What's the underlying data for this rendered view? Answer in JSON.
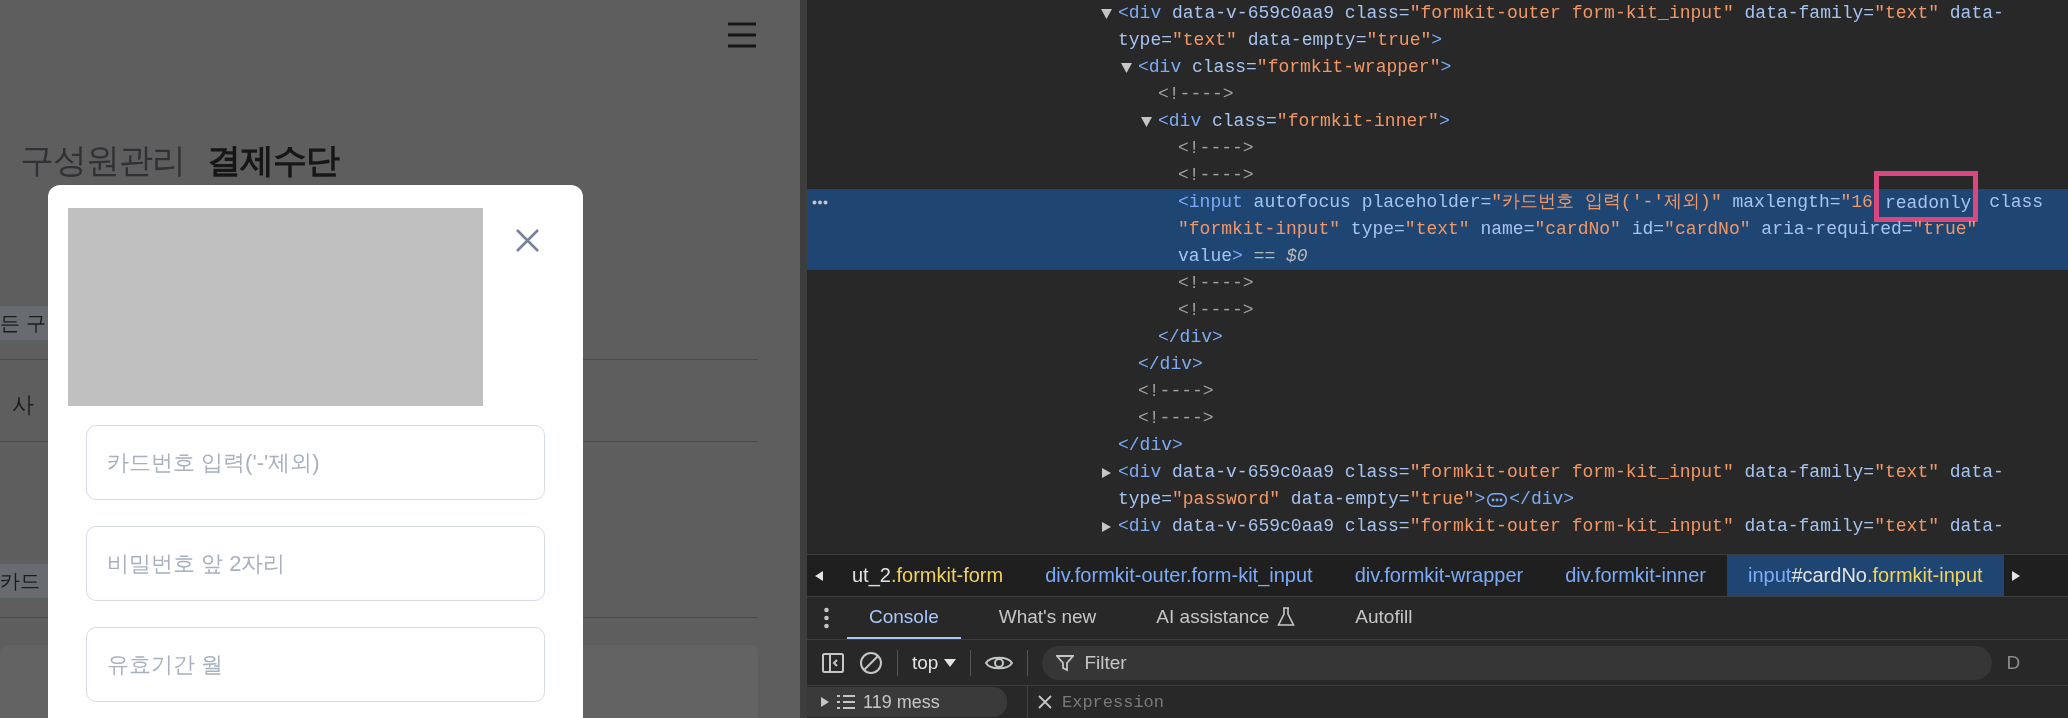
{
  "page": {
    "heading_tabs": [
      {
        "label": "구성원관리",
        "selected": false
      },
      {
        "label": "결제수단",
        "selected": true
      }
    ],
    "background_rows": [
      {
        "kind": "chip",
        "text": "든 구"
      },
      {
        "kind": "text",
        "text": "사"
      },
      {
        "kind": "chip",
        "text": "카드"
      }
    ]
  },
  "modal": {
    "fields": [
      {
        "placeholder": "카드번호 입력('-'제외)"
      },
      {
        "placeholder": "비밀번호 앞 2자리"
      },
      {
        "placeholder": "유효기간 월"
      }
    ]
  },
  "devtools": {
    "elements_tree": [
      {
        "expanded": true,
        "selected": false,
        "lines": [
          [
            {
              "kind": "tag",
              "text": "<div"
            },
            {
              "kind": "attr",
              "text": " data-v-659c0aa9 class="
            },
            {
              "kind": "value",
              "text": "\"formkit-outer form-kit_input\""
            },
            {
              "kind": "attr",
              "text": " data-family="
            },
            {
              "kind": "value",
              "text": "\"text\""
            },
            {
              "kind": "attr",
              "text": " data-"
            }
          ],
          [
            {
              "kind": "attr",
              "text": "type="
            },
            {
              "kind": "value",
              "text": "\"text\""
            },
            {
              "kind": "attr",
              "text": " data-empty="
            },
            {
              "kind": "value",
              "text": "\"true\""
            },
            {
              "kind": "tag",
              "text": ">"
            }
          ]
        ],
        "children": [
          {
            "expanded": true,
            "selected": false,
            "lines": [
              [
                {
                  "kind": "tag",
                  "text": "<div"
                },
                {
                  "kind": "attr",
                  "text": " class="
                },
                {
                  "kind": "value",
                  "text": "\"formkit-wrapper\""
                },
                {
                  "kind": "tag",
                  "text": ">"
                }
              ]
            ],
            "children": [
              {
                "selected": false,
                "lines": [
                  [
                    {
                      "kind": "comment",
                      "text": "<!---->"
                    }
                  ]
                ]
              },
              {
                "expanded": true,
                "selected": false,
                "lines": [
                  [
                    {
                      "kind": "tag",
                      "text": "<div"
                    },
                    {
                      "kind": "attr",
                      "text": " class="
                    },
                    {
                      "kind": "value",
                      "text": "\"formkit-inner\""
                    },
                    {
                      "kind": "tag",
                      "text": ">"
                    }
                  ]
                ],
                "children": [
                  {
                    "selected": false,
                    "lines": [
                      [
                        {
                          "kind": "comment",
                          "text": "<!---->"
                        }
                      ]
                    ]
                  },
                  {
                    "selected": false,
                    "lines": [
                      [
                        {
                          "kind": "comment",
                          "text": "<!---->"
                        }
                      ]
                    ]
                  },
                  {
                    "selected": true,
                    "lines": [
                      [
                        {
                          "kind": "tag",
                          "text": "<input"
                        },
                        {
                          "kind": "attr",
                          "text": " autofocus placeholder="
                        },
                        {
                          "kind": "value",
                          "text": "\"카드번호 입력('-'제외)\""
                        },
                        {
                          "kind": "attr",
                          "text": " maxlength="
                        },
                        {
                          "kind": "value",
                          "text": "\"16"
                        },
                        {
                          "kind": "highlight",
                          "text": "readonly"
                        },
                        {
                          "kind": "attr",
                          "text": " class"
                        }
                      ],
                      [
                        {
                          "kind": "value",
                          "text": "\"formkit-input\""
                        },
                        {
                          "kind": "attr",
                          "text": " type="
                        },
                        {
                          "kind": "value",
                          "text": "\"text\""
                        },
                        {
                          "kind": "attr",
                          "text": " name="
                        },
                        {
                          "kind": "value",
                          "text": "\"cardNo\""
                        },
                        {
                          "kind": "attr",
                          "text": " id="
                        },
                        {
                          "kind": "value",
                          "text": "\"cardNo\""
                        },
                        {
                          "kind": "attr",
                          "text": " aria-required="
                        },
                        {
                          "kind": "value",
                          "text": "\"true\""
                        }
                      ],
                      [
                        {
                          "kind": "attr",
                          "text": "value"
                        },
                        {
                          "kind": "tag",
                          "text": ">"
                        },
                        {
                          "kind": "hint",
                          "text": " == "
                        },
                        {
                          "kind": "var",
                          "text": "$0"
                        }
                      ]
                    ]
                  },
                  {
                    "selected": false,
                    "lines": [
                      [
                        {
                          "kind": "comment",
                          "text": "<!---->"
                        }
                      ]
                    ]
                  },
                  {
                    "selected": false,
                    "lines": [
                      [
                        {
                          "kind": "comment",
                          "text": "<!---->"
                        }
                      ]
                    ]
                  }
                ],
                "closing": [
                  {
                    "kind": "tag",
                    "text": "</div>"
                  }
                ]
              }
            ],
            "closing": [
              {
                "kind": "tag",
                "text": "</div>"
              }
            ]
          },
          {
            "selected": false,
            "lines": [
              [
                {
                  "kind": "comment",
                  "text": "<!---->"
                }
              ]
            ]
          },
          {
            "selected": false,
            "lines": [
              [
                {
                  "kind": "comment",
                  "text": "<!---->"
                }
              ]
            ]
          }
        ],
        "closing": [
          {
            "kind": "tag",
            "text": "</div>"
          }
        ]
      },
      {
        "expanded": false,
        "selected": false,
        "lines": [
          [
            {
              "kind": "tag",
              "text": "<div"
            },
            {
              "kind": "attr",
              "text": " data-v-659c0aa9 class="
            },
            {
              "kind": "value",
              "text": "\"formkit-outer form-kit_input\""
            },
            {
              "kind": "attr",
              "text": " data-family="
            },
            {
              "kind": "value",
              "text": "\"text\""
            },
            {
              "kind": "attr",
              "text": " data-"
            }
          ],
          [
            {
              "kind": "attr",
              "text": "type="
            },
            {
              "kind": "value",
              "text": "\"password\""
            },
            {
              "kind": "attr",
              "text": " data-empty="
            },
            {
              "kind": "value",
              "text": "\"true\""
            },
            {
              "kind": "tag",
              "text": ">"
            },
            {
              "kind": "more"
            },
            {
              "kind": "tag",
              "text": "</div>"
            }
          ]
        ]
      },
      {
        "expanded": false,
        "selected": false,
        "lines": [
          [
            {
              "kind": "tag",
              "text": "<div"
            },
            {
              "kind": "attr",
              "text": " data-v-659c0aa9 class="
            },
            {
              "kind": "value",
              "text": "\"formkit-outer form-kit_input\""
            },
            {
              "kind": "attr",
              "text": " data-family="
            },
            {
              "kind": "value",
              "text": "\"text\""
            },
            {
              "kind": "attr",
              "text": " data-"
            }
          ]
        ]
      }
    ],
    "breadcrumbs": [
      {
        "selected": false,
        "parts": [
          {
            "kind": "id",
            "text": "ut_2"
          },
          {
            "kind": "class",
            "text": ".formkit-form"
          }
        ]
      },
      {
        "selected": false,
        "parts": [
          {
            "kind": "tag",
            "text": "div.formkit-outer.form-kit_input"
          }
        ]
      },
      {
        "selected": false,
        "parts": [
          {
            "kind": "tag",
            "text": "div.formkit-wrapper"
          }
        ]
      },
      {
        "selected": false,
        "parts": [
          {
            "kind": "tag",
            "text": "div.formkit-inner"
          }
        ]
      },
      {
        "selected": true,
        "parts": [
          {
            "kind": "tag",
            "text": "input"
          },
          {
            "kind": "id",
            "text": "#cardNo"
          },
          {
            "kind": "class",
            "text": ".formkit-input"
          }
        ]
      }
    ],
    "drawer_tabs": [
      {
        "label": "Console",
        "selected": true,
        "experimental": false
      },
      {
        "label": "What's new",
        "selected": false,
        "experimental": false
      },
      {
        "label": "AI assistance",
        "selected": false,
        "experimental": true
      },
      {
        "label": "Autofill",
        "selected": false,
        "experimental": false
      }
    ],
    "console_toolbar": {
      "context": "top",
      "filter_placeholder": "Filter",
      "levels": "D"
    },
    "sidebar_toggle": {
      "count": "119 mess"
    },
    "expression": {
      "placeholder": "Expression"
    }
  }
}
